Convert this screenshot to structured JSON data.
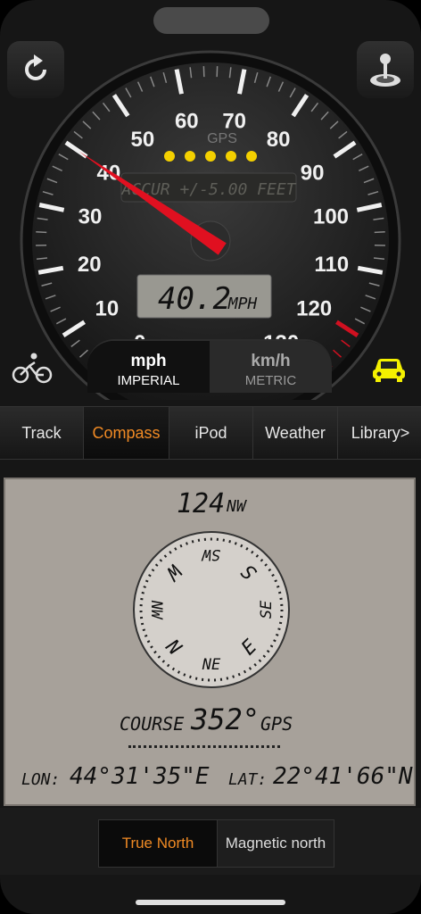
{
  "speedometer": {
    "tick_labels": [
      "0",
      "10",
      "20",
      "30",
      "40",
      "50",
      "60",
      "70",
      "80",
      "90",
      "100",
      "110",
      "120",
      "130"
    ],
    "max_speed": 130,
    "needle_speed": 40,
    "gps_label": "GPS",
    "gps_signal_dots": 5,
    "accuracy_text": "ACCUR +/-5.00 FEET",
    "speed_value": "40.2",
    "speed_unit": "MPH"
  },
  "unit_toggle": {
    "left": {
      "unit": "mph",
      "system": "IMPERIAL"
    },
    "right": {
      "unit": "km/h",
      "system": "METRIC"
    }
  },
  "tabs": [
    {
      "label": "Track",
      "active": false
    },
    {
      "label": "Compass",
      "active": true
    },
    {
      "label": "iPod",
      "active": false
    },
    {
      "label": "Weather",
      "active": false
    },
    {
      "label": "Library>",
      "active": false
    }
  ],
  "compass": {
    "heading_value": "124",
    "heading_dir": "NW",
    "dial_letters": [
      "N",
      "NE",
      "E",
      "SE",
      "S",
      "SW",
      "W",
      "NW"
    ],
    "course_label": "COURSE",
    "course_value": "352°",
    "course_source": "GPS",
    "lon_label": "LON:",
    "lon_value": "44°31'35\"E",
    "lat_label": "LAT:",
    "lat_value": "22°41'66\"N"
  },
  "north_toggle": {
    "true_north": "True North",
    "magnetic_north": "Magnetic north"
  },
  "colors": {
    "accent": "#f08a24",
    "needle": "#e01020",
    "gps_dot": "#f4d000",
    "car_icon": "#f4f000"
  }
}
